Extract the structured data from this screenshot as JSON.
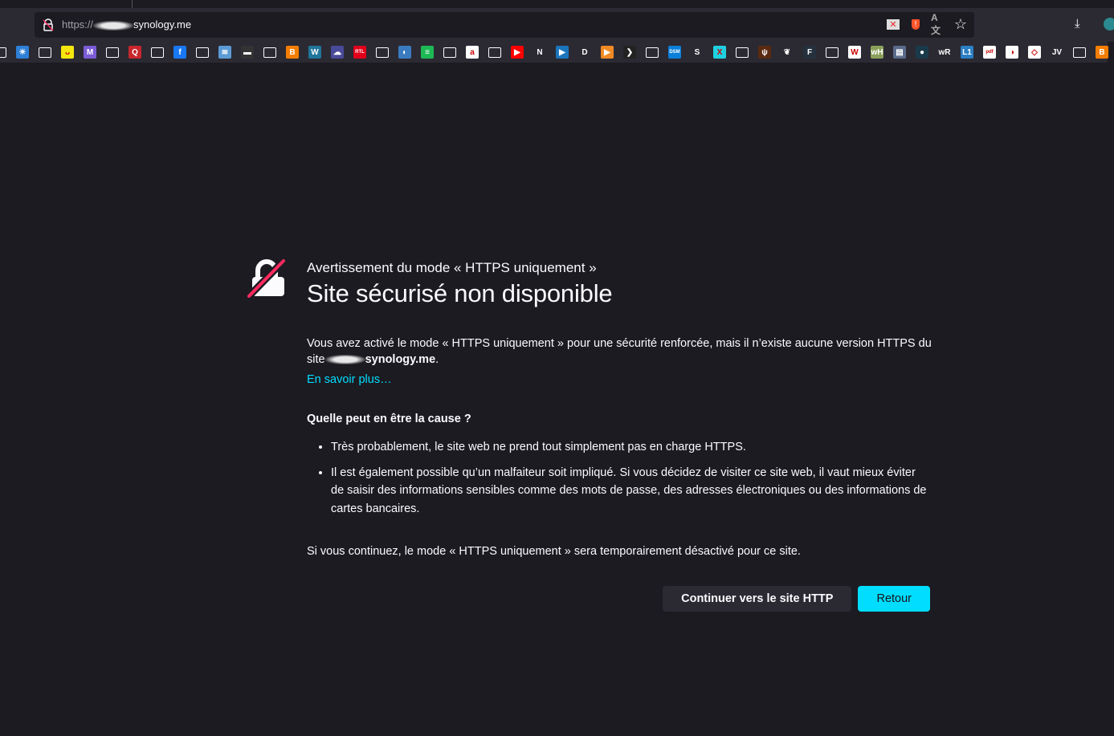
{
  "browser": {
    "url_scheme": "https://",
    "url_host": "synology.me",
    "url_icons": [
      "blocked-content-icon",
      "brave-shield-icon",
      "translate-icon",
      "bookmark-star-icon"
    ],
    "bookmarks": [
      {
        "icon": "folder",
        "color": "",
        "label": ""
      },
      {
        "icon": "sun",
        "color": "#2e7fd6",
        "label": "☀"
      },
      {
        "icon": "folder",
        "color": "",
        "label": ""
      },
      {
        "icon": "smiley",
        "color": "#f5e60f",
        "label": "ᴗ"
      },
      {
        "icon": "m",
        "color": "#7b5cd6",
        "label": "M"
      },
      {
        "icon": "folder",
        "color": "",
        "label": ""
      },
      {
        "icon": "q",
        "color": "#c8262b",
        "label": "Q"
      },
      {
        "icon": "folder",
        "color": "",
        "label": ""
      },
      {
        "icon": "facebook",
        "color": "#1877f2",
        "label": "f"
      },
      {
        "icon": "folder",
        "color": "",
        "label": ""
      },
      {
        "icon": "image",
        "color": "#5b9bd5",
        "label": "≋"
      },
      {
        "icon": "hat",
        "color": "#333",
        "label": "▬"
      },
      {
        "icon": "folder",
        "color": "",
        "label": ""
      },
      {
        "icon": "blogger",
        "color": "#f57d00",
        "label": "B"
      },
      {
        "icon": "wordpress",
        "color": "#21759b",
        "label": "W"
      },
      {
        "icon": "cloud",
        "color": "#4a4a9a",
        "label": "☁"
      },
      {
        "icon": "rtl",
        "color": "#e2001a",
        "label": "RTL"
      },
      {
        "icon": "folder",
        "color": "",
        "label": ""
      },
      {
        "icon": "globe",
        "color": "#3a7bbf",
        "label": "◐"
      },
      {
        "icon": "spotify",
        "color": "#1db954",
        "label": "≡"
      },
      {
        "icon": "folder",
        "color": "",
        "label": ""
      },
      {
        "icon": "amazon",
        "color": "#ffffff",
        "label": "a"
      },
      {
        "icon": "folder",
        "color": "",
        "label": ""
      },
      {
        "icon": "youtube",
        "color": "#ff0000",
        "label": "▶"
      },
      {
        "icon": "netflix",
        "color": "#2b2a33",
        "label": "N"
      },
      {
        "icon": "play",
        "color": "#1b75bc",
        "label": "▶"
      },
      {
        "icon": "disney",
        "color": "#2b2a33",
        "label": "D"
      },
      {
        "icon": "play-orange",
        "color": "#f08a24",
        "label": "▶"
      },
      {
        "icon": "plex",
        "color": "#222",
        "label": "❯"
      },
      {
        "icon": "folder",
        "color": "",
        "label": ""
      },
      {
        "icon": "dsm",
        "color": "#0a7fd9",
        "label": "DSM"
      },
      {
        "icon": "s",
        "color": "#2b2a33",
        "label": "S"
      },
      {
        "icon": "x",
        "color": "#1fd1e0",
        "label": "X"
      },
      {
        "icon": "folder",
        "color": "",
        "label": ""
      },
      {
        "icon": "flame",
        "color": "#5a2a10",
        "label": "ψ"
      },
      {
        "icon": "leaf",
        "color": "#2b2a33",
        "label": "❦"
      },
      {
        "icon": "f",
        "color": "#24313d",
        "label": "F"
      },
      {
        "icon": "folder",
        "color": "",
        "label": ""
      },
      {
        "icon": "wikipedia",
        "color": "#ffffff",
        "label": "W"
      },
      {
        "icon": "wh",
        "color": "#8aa05a",
        "label": "wH"
      },
      {
        "icon": "doc",
        "color": "#5a6a8a",
        "label": "▤"
      },
      {
        "icon": "bird",
        "color": "#1a3a4a",
        "label": "●"
      },
      {
        "icon": "wr",
        "color": "#2b2a33",
        "label": "wR"
      },
      {
        "icon": "l1",
        "color": "#2b7fc4",
        "label": "L1"
      },
      {
        "icon": "pdf",
        "color": "#ffffff",
        "label": "pdf"
      },
      {
        "icon": "flag",
        "color": "#ffffff",
        "label": "◑"
      },
      {
        "icon": "outline",
        "color": "#ffffff",
        "label": "◇"
      },
      {
        "icon": "jv",
        "color": "#2b2a33",
        "label": "JV"
      },
      {
        "icon": "folder",
        "color": "",
        "label": ""
      },
      {
        "icon": "blogger",
        "color": "#f57d00",
        "label": "B"
      }
    ]
  },
  "page": {
    "eyebrow": "Avertissement du mode « HTTPS uniquement »",
    "title": "Site sécurisé non disponible",
    "intro": "Vous avez activé le mode « HTTPS uniquement » pour une sécurité renforcée, mais il n’existe aucune version HTTPS du site",
    "site": "synology.me",
    "learn_more": "En savoir plus…",
    "cause_heading": "Quelle peut en être la cause ?",
    "causes": [
      "Très probablement, le site web ne prend tout simplement pas en charge HTTPS.",
      "Il est également possible qu’un malfaiteur soit impliqué. Si vous décidez de visiter ce site web, il vaut mieux éviter de saisir des informations sensibles comme des mots de passe, des adresses électroniques ou des informations de cartes bancaires."
    ],
    "continue_note": "Si vous continuez, le mode « HTTPS uniquement » sera temporairement désactivé pour ce site.",
    "continue_button": "Continuer vers le site HTTP",
    "back_button": "Retour"
  },
  "colors": {
    "accent": "#00ddff",
    "background": "#1c1b22",
    "slash": "#ff2a5f"
  }
}
